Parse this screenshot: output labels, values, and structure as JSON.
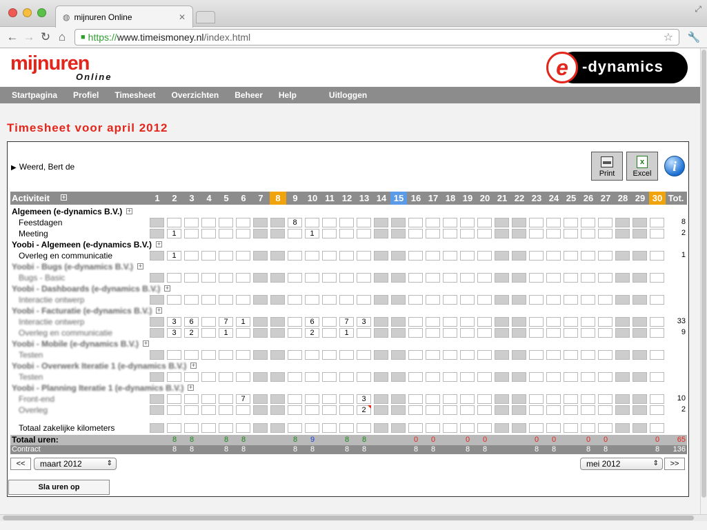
{
  "browser": {
    "tab_title": "mijnuren Online",
    "url_scheme": "https://",
    "url_host": "www.timeismoney.nl",
    "url_path": "/index.html"
  },
  "header": {
    "logo_main": "mijnuren",
    "logo_sub": "Online",
    "brand_e": "e",
    "brand_text": "-dynamics"
  },
  "menu": [
    "Startpagina",
    "Profiel",
    "Timesheet",
    "Overzichten",
    "Beheer",
    "Help",
    "Uitloggen"
  ],
  "page_title": "Timesheet voor april 2012",
  "user_name": "Weerd, Bert de",
  "buttons": {
    "print": "Print",
    "excel": "Excel",
    "info": "i",
    "save": "Sla uren op"
  },
  "grid": {
    "activity_header": "Activiteit",
    "total_header": "Tot.",
    "days": [
      "1",
      "2",
      "3",
      "4",
      "5",
      "6",
      "7",
      "8",
      "9",
      "10",
      "11",
      "12",
      "13",
      "14",
      "15",
      "16",
      "17",
      "18",
      "19",
      "20",
      "21",
      "22",
      "23",
      "24",
      "25",
      "26",
      "27",
      "28",
      "29",
      "30"
    ],
    "weekend_days": [
      1,
      7,
      8,
      14,
      15,
      21,
      22,
      28,
      29
    ],
    "highlight_weekend_headers": [
      8,
      30
    ],
    "today": 15,
    "rows": [
      {
        "type": "group",
        "label": "Algemeen (e-dynamics B.V.)"
      },
      {
        "type": "activity",
        "label": "Feestdagen",
        "values": {
          "9": "8"
        },
        "total": "8"
      },
      {
        "type": "activity",
        "label": "Meeting",
        "values": {
          "2": "1",
          "10": "1"
        },
        "total": "2"
      },
      {
        "type": "group",
        "label": "Yoobi - Algemeen (e-dynamics B.V.)"
      },
      {
        "type": "activity",
        "label": "Overleg en communicatie",
        "values": {
          "2": "1"
        },
        "total": "1"
      },
      {
        "type": "group",
        "label": "Yoobi - Bugs (e-dynamics B.V.)",
        "blurred": true
      },
      {
        "type": "activity",
        "label": "Bugs - Basic",
        "values": {},
        "total": "",
        "blurred": true
      },
      {
        "type": "group",
        "label": "Yoobi - Dashboards (e-dynamics B.V.)",
        "blurred": true
      },
      {
        "type": "activity",
        "label": "Interactie ontwerp",
        "values": {},
        "total": "",
        "blurred": true
      },
      {
        "type": "group",
        "label": "Yoobi - Facturatie (e-dynamics B.V.)",
        "blurred": true
      },
      {
        "type": "activity",
        "label": "Interactie ontwerp",
        "values": {
          "2": "3",
          "3": "6",
          "5": "7",
          "6": "1",
          "10": "6",
          "12": "7",
          "13": "3"
        },
        "total": "33",
        "blurred": true
      },
      {
        "type": "activity",
        "label": "Overleg en communicatie",
        "values": {
          "2": "3",
          "3": "2",
          "5": "1",
          "10": "2",
          "12": "1"
        },
        "total": "9",
        "blurred": true
      },
      {
        "type": "group",
        "label": "Yoobi - Mobile (e-dynamics B.V.)",
        "blurred": true
      },
      {
        "type": "activity",
        "label": "Testen",
        "values": {},
        "total": "",
        "blurred": true
      },
      {
        "type": "group",
        "label": "Yoobi - Overwerk Iteratie 1 (e-dynamics B.V.)",
        "blurred": true
      },
      {
        "type": "activity",
        "label": "Testen",
        "values": {},
        "total": "",
        "blurred": true
      },
      {
        "type": "group",
        "label": "Yoobi - Planning Iteratie 1 (e-dynamics B.V.)",
        "blurred": true
      },
      {
        "type": "activity",
        "label": "Front-end",
        "values": {
          "6": "7",
          "13": "3"
        },
        "total": "10",
        "blurred": true
      },
      {
        "type": "activity",
        "label": "Overleg",
        "values": {
          "13": "2"
        },
        "total": "2",
        "note_day": 13,
        "blurred": true
      },
      {
        "type": "spacer"
      },
      {
        "type": "activity",
        "label": "Totaal zakelijke kilometers",
        "values": {},
        "total": ""
      }
    ],
    "totals_label": "Totaal uren:",
    "totals": {
      "2": "8",
      "3": "8",
      "5": "8",
      "6": "8",
      "9": "8",
      "10": "9",
      "12": "8",
      "13": "8",
      "16": "0",
      "17": "0",
      "19": "0",
      "20": "0",
      "23": "0",
      "24": "0",
      "26": "0",
      "27": "0",
      "30": "0"
    },
    "totals_colors": {
      "green": "#1a8a1a",
      "blue": "#1a3fd6",
      "red": "#e3261b"
    },
    "totals_grand": "65",
    "contract_label": "Contract",
    "contract": {
      "2": "8",
      "3": "8",
      "5": "8",
      "6": "8",
      "9": "8",
      "10": "8",
      "12": "8",
      "13": "8",
      "16": "8",
      "17": "8",
      "19": "8",
      "20": "8",
      "23": "8",
      "24": "8",
      "26": "8",
      "27": "8",
      "30": "8"
    },
    "contract_grand": "136"
  },
  "month_nav": {
    "prev": "<<",
    "prev_month": "maart 2012",
    "next_month": "mei 2012",
    "next": ">>"
  },
  "colors": {
    "accent": "#e3261b",
    "menu_bg": "#8c8c8c",
    "weekend_header": "#f0a30a",
    "today_header": "#5a9ae6"
  }
}
